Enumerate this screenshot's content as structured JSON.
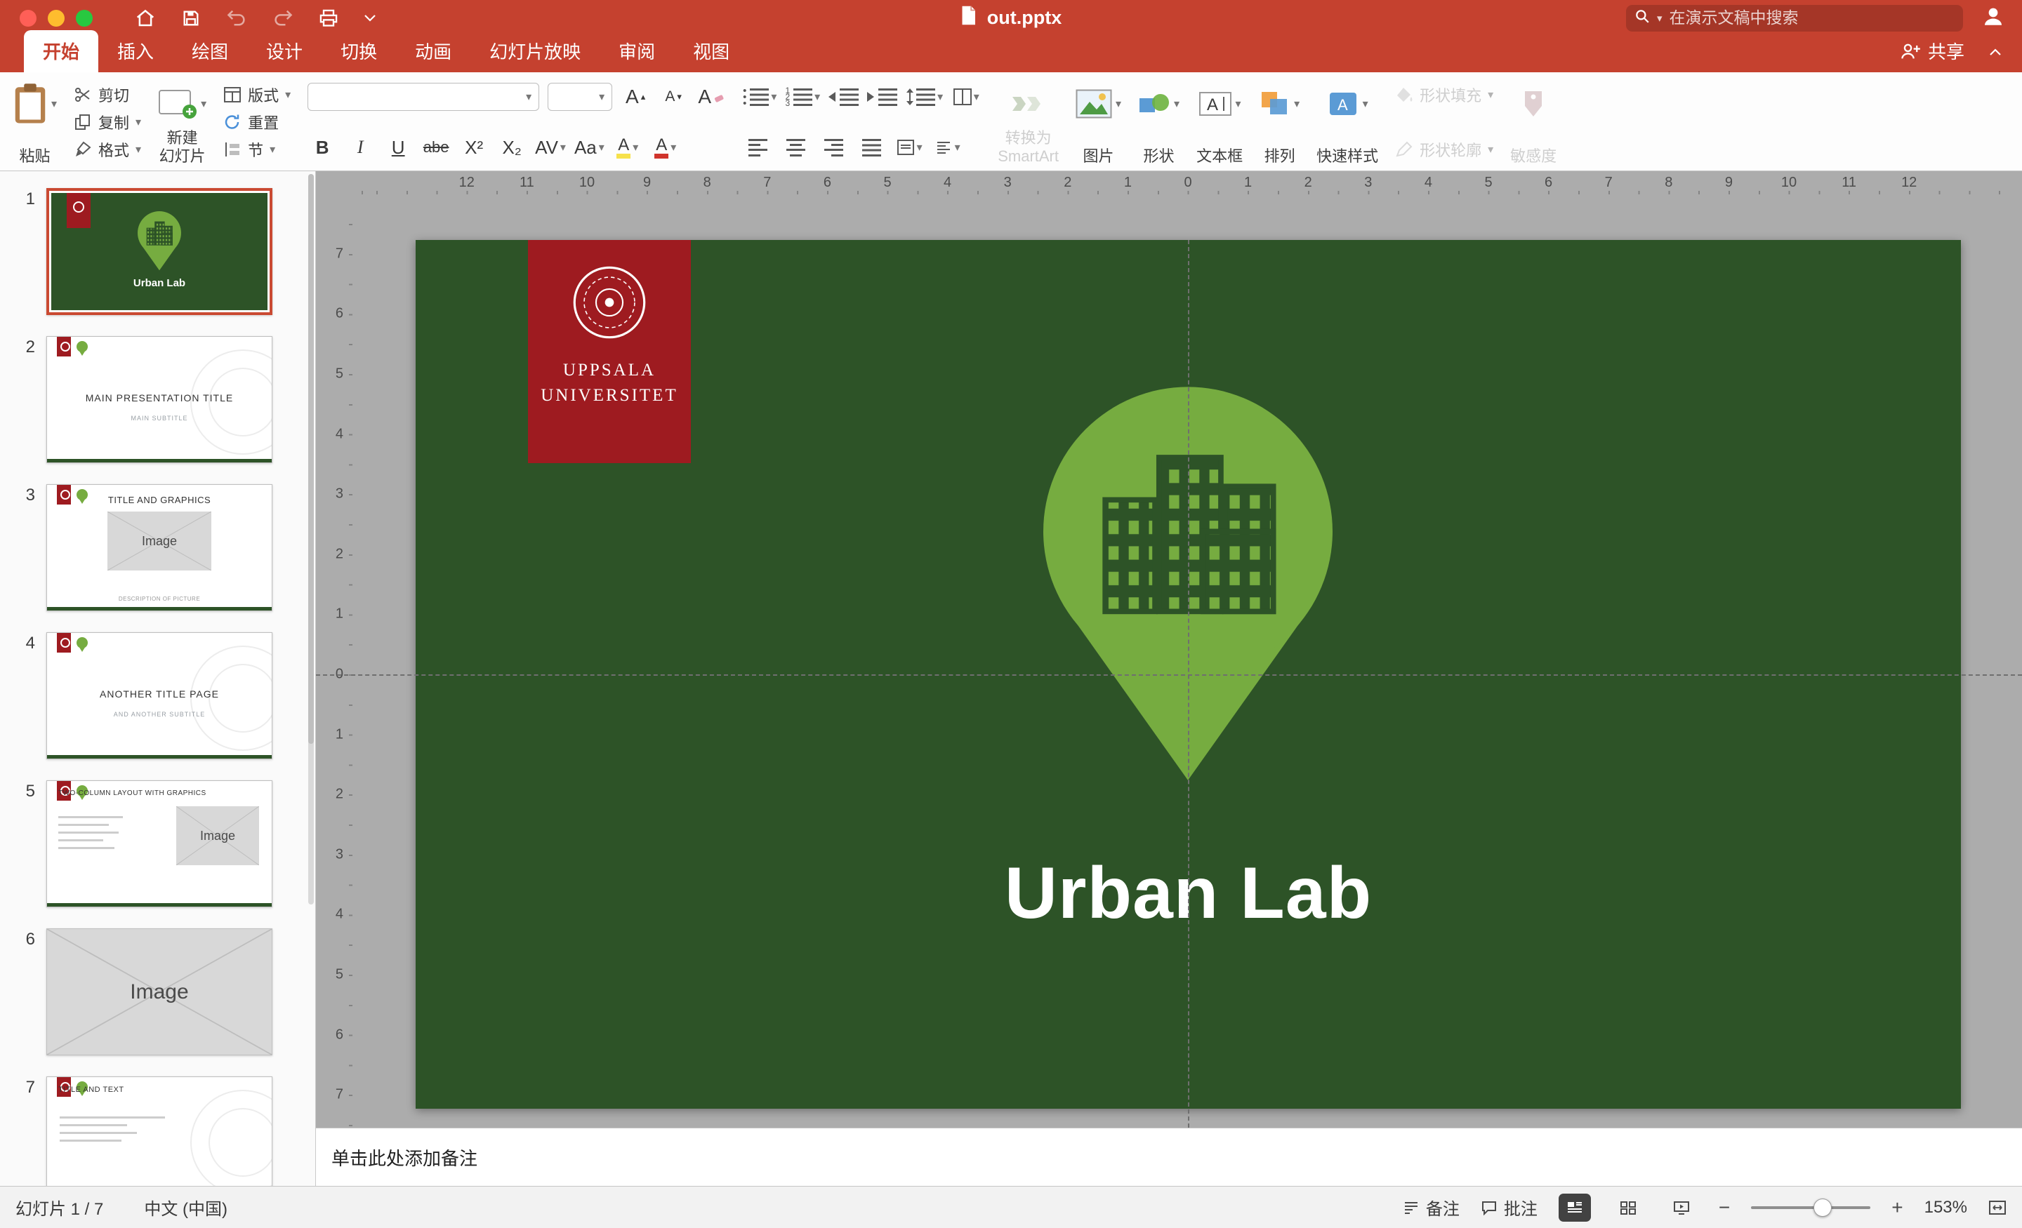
{
  "app": {
    "title": "out.pptx"
  },
  "titlebar": {
    "search_placeholder": "在演示文稿中搜索"
  },
  "tabs": [
    {
      "label": "开始"
    },
    {
      "label": "插入"
    },
    {
      "label": "绘图"
    },
    {
      "label": "设计"
    },
    {
      "label": "切换"
    },
    {
      "label": "动画"
    },
    {
      "label": "幻灯片放映"
    },
    {
      "label": "审阅"
    },
    {
      "label": "视图"
    }
  ],
  "share": {
    "label": "共享"
  },
  "ribbon": {
    "paste": "粘贴",
    "cut": "剪切",
    "copy": "复制",
    "format_painter": "格式",
    "new_slide_line1": "新建",
    "new_slide_line2": "幻灯片",
    "layout": "版式",
    "reset": "重置",
    "section": "节",
    "font_name_value": "",
    "font_size_value": "",
    "bold": "B",
    "italic": "I",
    "underline": "U",
    "strikethrough": "abe",
    "superscript": "X²",
    "subscript": "X₂",
    "increase_font": "A",
    "decrease_font": "A",
    "clear_format": "A",
    "char_spacing": "AV",
    "change_case": "Aa",
    "highlight": "A",
    "font_color": "A",
    "smartart_line1": "转换为",
    "smartart_line2": "SmartArt",
    "picture": "图片",
    "shapes": "形状",
    "textbox": "文本框",
    "arrange": "排列",
    "quick_styles": "快速样式",
    "shape_fill": "形状填充",
    "shape_outline": "形状轮廓",
    "sensitivity": "敏感度"
  },
  "thumbnails": [
    {
      "num": "1",
      "title": "Urban Lab"
    },
    {
      "num": "2",
      "title": "MAIN PRESENTATION TITLE",
      "subtitle": "MAIN SUBTITLE"
    },
    {
      "num": "3",
      "title": "TITLE AND GRAPHICS",
      "image_label": "Image",
      "caption": "DESCRIPTION OF PICTURE"
    },
    {
      "num": "4",
      "title": "ANOTHER TITLE PAGE",
      "subtitle": "AND ANOTHER SUBTITLE"
    },
    {
      "num": "5",
      "title": "TWO-COLUMN LAYOUT WITH GRAPHICS",
      "image_label": "Image"
    },
    {
      "num": "6",
      "image_label": "Image"
    },
    {
      "num": "7",
      "title": "TITLE AND TEXT"
    }
  ],
  "slide": {
    "org_line1": "UPPSALA",
    "org_line2": "UNIVERSITET",
    "title": "Urban Lab"
  },
  "notes": {
    "placeholder": "单击此处添加备注"
  },
  "statusbar": {
    "slide_counter": "幻灯片 1 / 7",
    "language": "中文 (中国)",
    "notes_label": "备注",
    "comments_label": "批注",
    "zoom_level": "153%"
  },
  "rulers": {
    "horizontal": [
      "12",
      "11",
      "10",
      "9",
      "8",
      "7",
      "6",
      "5",
      "4",
      "3",
      "2",
      "1",
      "0",
      "1",
      "2",
      "3",
      "4",
      "5",
      "6",
      "7",
      "8",
      "9",
      "10",
      "11",
      "12"
    ],
    "vertical": [
      "7",
      "6",
      "5",
      "4",
      "3",
      "2",
      "1",
      "0",
      "1",
      "2",
      "3",
      "4",
      "5",
      "6",
      "7"
    ]
  },
  "colors": {
    "titlebar_red": "#C5412F",
    "slide_green": "#2D5327",
    "pin_green": "#76AC40",
    "uppsala_red": "#9E1B20",
    "selection_orange": "#CA4A32"
  }
}
